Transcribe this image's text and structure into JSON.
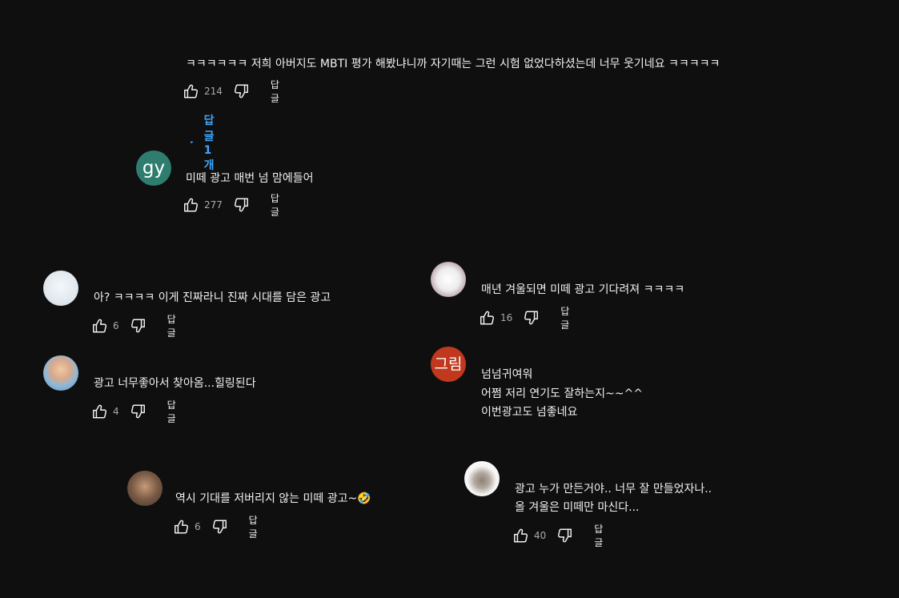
{
  "comments": [
    {
      "lines": [
        "ㅋㅋㅋㅋㅋㅋ 저희 아버지도 MBTI 평가 해봤냐니까 자기때는 그런 시험 없었다하셨는데 너무 웃기네요 ㅋㅋㅋㅋㅋ"
      ],
      "likes": "214",
      "reply_label": "답글",
      "replies_toggle": "답글 1개"
    },
    {
      "avatar_initials": "gy",
      "avatar_color": "#2e7d6f",
      "lines": [
        "미떼 광고 매번 넘 맘에들어"
      ],
      "likes": "277",
      "reply_label": "답글"
    },
    {
      "lines": [
        "아? ㅋㅋㅋㅋ 이게 진짜라니 진짜 시대를 담은 광고"
      ],
      "likes": "6",
      "reply_label": "답글"
    },
    {
      "lines": [
        "광고 너무좋아서 찾아옴...힐링된다"
      ],
      "likes": "4",
      "reply_label": "답글"
    },
    {
      "lines": [
        "역시 기대를 저버리지 않는 미떼 광고~🤣"
      ],
      "likes": "6",
      "reply_label": "답글"
    },
    {
      "lines": [
        "매년 겨울되면 미떼 광고 기다려져 ㅋㅋㅋㅋ"
      ],
      "likes": "16",
      "reply_label": "답글"
    },
    {
      "avatar_initials": "그림",
      "avatar_color": "#c0391f",
      "lines": [
        "넘넘귀여워",
        "어쩜 저리 연기도 잘하는지~~^^",
        "이번광고도 넘좋네요"
      ]
    },
    {
      "lines": [
        "광고 누가 만든거야.. 너무 잘 만들었자나..",
        "올 겨울은 미떼만 마신다..."
      ],
      "likes": "40",
      "reply_label": "답글"
    }
  ],
  "icons": {
    "like": "thumbs-up-icon",
    "dislike": "thumbs-down-icon",
    "expand": "caret-down-icon"
  },
  "colors": {
    "background": "#0f0f0f",
    "text": "#f1f1f1",
    "muted": "#aaaaaa",
    "link": "#3ea6ff"
  }
}
